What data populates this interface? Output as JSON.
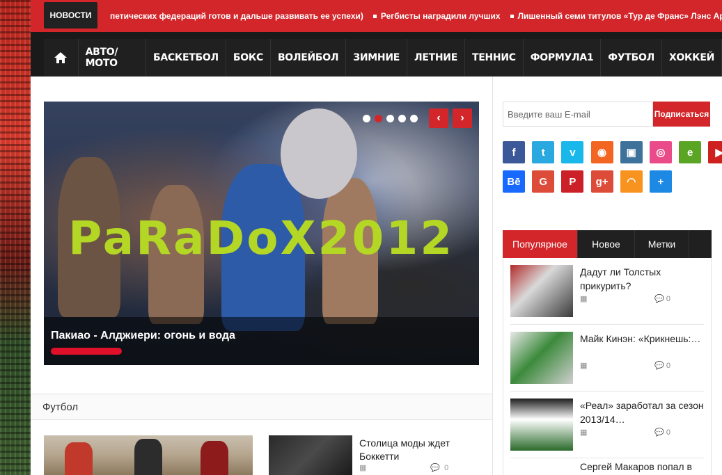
{
  "ticker": {
    "label": "НОВОСТИ",
    "items": [
      "петических федераций готов и дальше развивать ее успехи)",
      "Регбисты наградили лучших",
      "Лишенный семи титулов «Тур де Франс» Лэнс Армстронг"
    ]
  },
  "nav": {
    "items": [
      "АВТО/МОТО",
      "БАСКЕТБОЛ",
      "БОКС",
      "ВОЛЕЙБОЛ",
      "ЗИМНИЕ",
      "ЛЕТНИЕ",
      "ТЕННИС",
      "ФОРМУЛА1",
      "ФУТБОЛ",
      "ХОККЕЙ"
    ]
  },
  "slider": {
    "caption": "Пакиао - Алджиери: огонь и вода",
    "dot_count": 5,
    "active_dot": 2,
    "prev": "‹",
    "next": "›"
  },
  "watermark": "PaRaDoX2012",
  "section": {
    "title": "Футбол",
    "post_title": "Столица моды ждет Боккетти",
    "post_comments": "0"
  },
  "sidebar": {
    "email_placeholder": "Введите ваш E-mail",
    "subscribe": "Подписаться",
    "social_icons": [
      {
        "name": "facebook",
        "color": "#3b5998",
        "glyph": "f"
      },
      {
        "name": "twitter",
        "color": "#2aa9e0",
        "glyph": "t"
      },
      {
        "name": "vimeo",
        "color": "#1ab7ea",
        "glyph": "v"
      },
      {
        "name": "rss",
        "color": "#f26522",
        "glyph": "◉"
      },
      {
        "name": "instagram",
        "color": "#3f729b",
        "glyph": "▣"
      },
      {
        "name": "dribbble",
        "color": "#ea4c89",
        "glyph": "◎"
      },
      {
        "name": "evernote",
        "color": "#5ba525",
        "glyph": "e"
      },
      {
        "name": "youtube",
        "color": "#cd201f",
        "glyph": "▶"
      },
      {
        "name": "behance",
        "color": "#1769ff",
        "glyph": "Bē"
      },
      {
        "name": "google",
        "color": "#dd4b39",
        "glyph": "G"
      },
      {
        "name": "pinterest",
        "color": "#cb2027",
        "glyph": "P"
      },
      {
        "name": "google-plus",
        "color": "#dd4b39",
        "glyph": "g+"
      },
      {
        "name": "odnoklassniki",
        "color": "#f7931e",
        "glyph": "◠"
      },
      {
        "name": "addthis",
        "color": "#1e88e5",
        "glyph": "+"
      }
    ],
    "tabs": [
      "Популярное",
      "Новое",
      "Метки"
    ],
    "popular": [
      {
        "title": "Дадут ли Толстых прикурить?",
        "comments": "0"
      },
      {
        "title": "Майк Кинэн: «Крикнешь:…",
        "comments": "0"
      },
      {
        "title": "«Реал» заработал за сезон 2013/14…",
        "comments": "0"
      },
      {
        "title": "Сергей Макаров попал в",
        "comments": ""
      }
    ]
  },
  "colors": {
    "accent": "#d3262b",
    "dark": "#202020",
    "watermark": "#b4d624"
  }
}
